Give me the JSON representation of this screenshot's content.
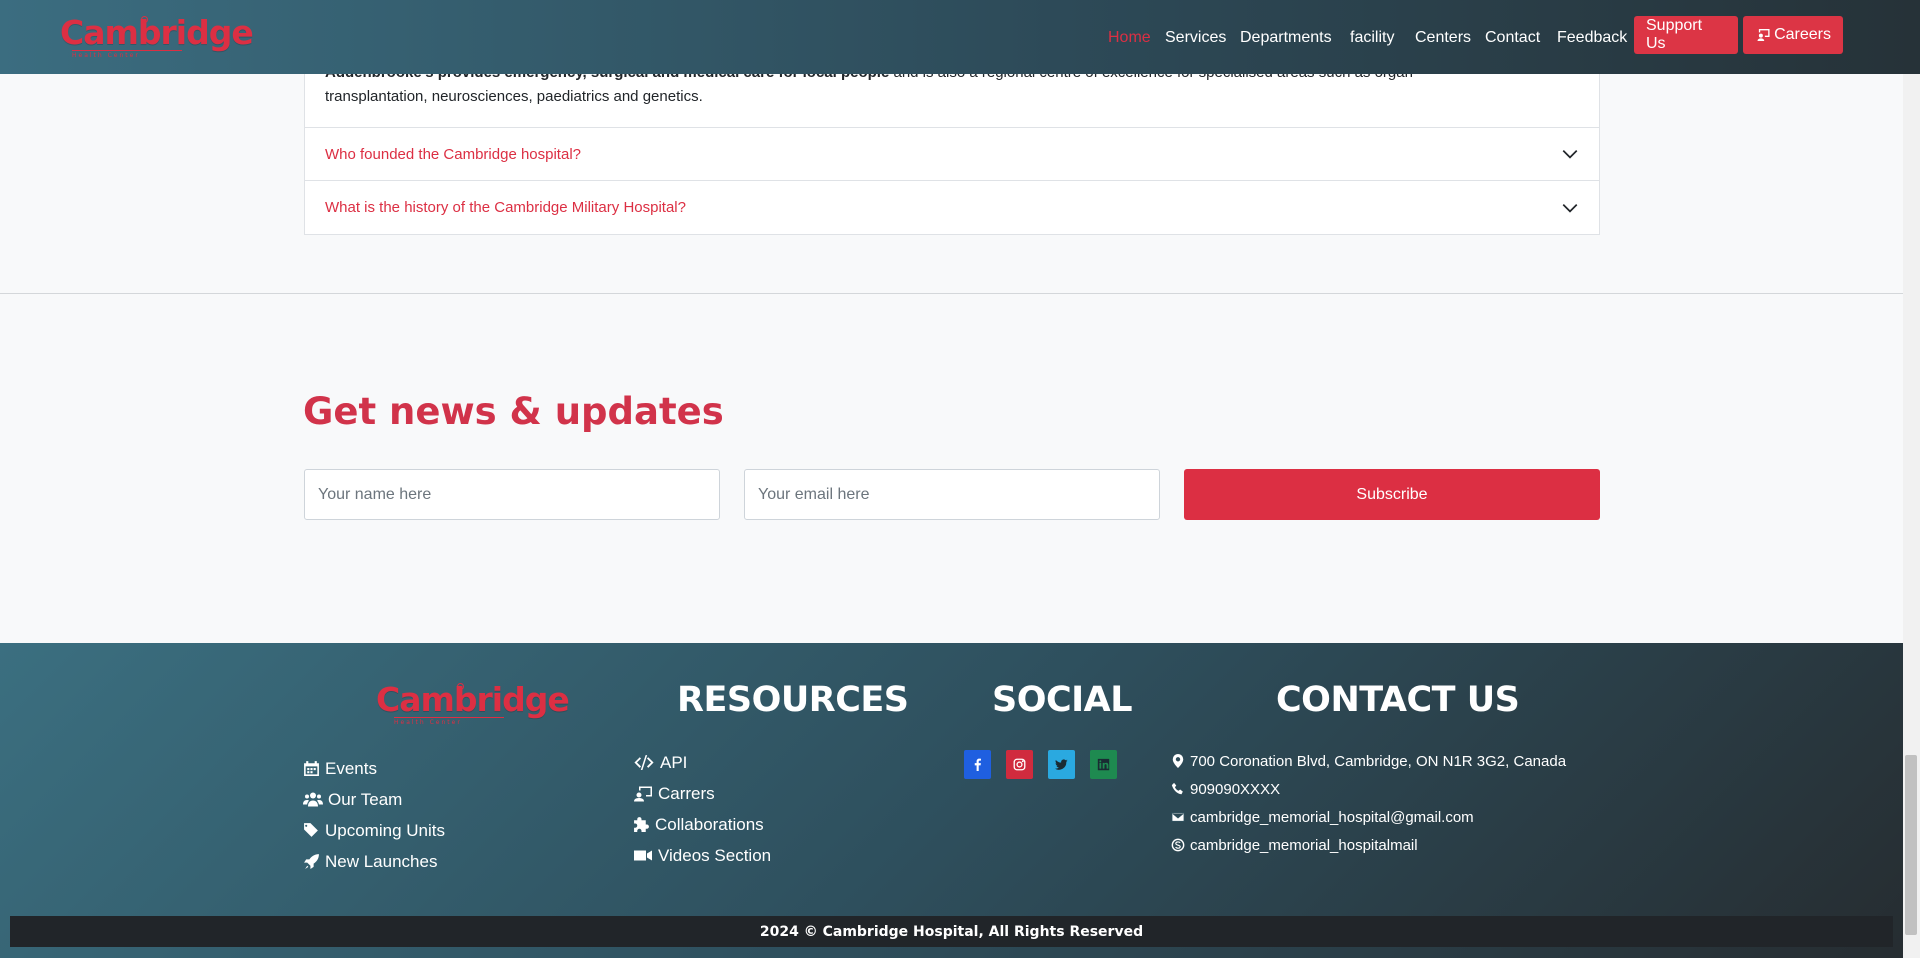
{
  "brand": {
    "name": "Cambridge",
    "tagline": "Health Center"
  },
  "nav": {
    "links": [
      "Home",
      "Services",
      "Departments",
      "facility",
      "Centers",
      "Contact",
      "Feedback"
    ],
    "support_label": "Support Us",
    "careers_label": "Careers"
  },
  "faq": {
    "answer_bold": "Addenbrooke's provides emergency, surgical and medical care for local people",
    "answer_rest": " and is also a regional centre of excellence for specialised areas such as organ",
    "answer_line2": "transplantation, neurosciences, paediatrics and genetics.",
    "questions": [
      "Who founded the Cambridge hospital?",
      "What is the history of the Cambridge Military Hospital?"
    ]
  },
  "newsletter": {
    "title": "Get news & updates",
    "name_placeholder": "Your name here",
    "email_placeholder": "Your email here",
    "subscribe_label": "Subscribe"
  },
  "footer": {
    "links": [
      "Events",
      "Our Team",
      "Upcoming Units",
      "New Launches"
    ],
    "resources_heading": "RESOURCES",
    "resources": [
      "API",
      "Carrers",
      "Collaborations",
      "Videos Section"
    ],
    "social_heading": "SOCIAL",
    "social": [
      "facebook-icon",
      "instagram-icon",
      "twitter-icon",
      "linkedin-icon"
    ],
    "contact_heading": "CONTACT US",
    "contact": {
      "address": "700 Coronation Blvd, Cambridge, ON N1R 3G2, Canada",
      "phone": "909090XXXX",
      "email": "cambridge_memorial_hospital@gmail.com",
      "skype": "cambridge_memorial_hospitalmail"
    },
    "copyright": "2024 © Cambridge Hospital, All Rights Reserved"
  },
  "colors": {
    "accent": "#dc2f43",
    "footer_dark": "#263238",
    "footer_teal": "#3b6f80"
  }
}
